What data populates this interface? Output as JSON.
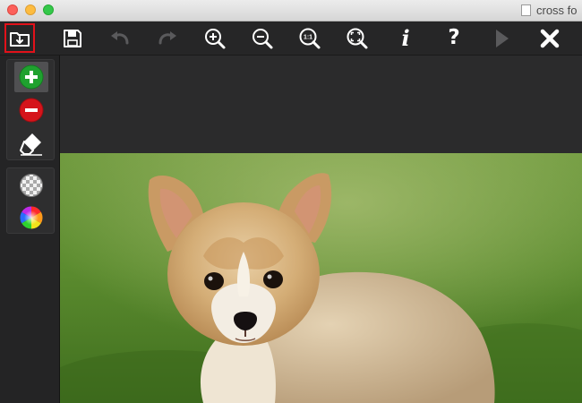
{
  "window": {
    "title": "cross fo",
    "traffic_lights": [
      "close",
      "minimize",
      "maximize"
    ]
  },
  "toolbar": {
    "items": [
      {
        "name": "open-folder",
        "icon": "folder-download-icon",
        "highlighted": true
      },
      {
        "name": "save",
        "icon": "floppy-disk-icon"
      },
      {
        "name": "undo",
        "icon": "undo-arrow-icon",
        "enabled": false
      },
      {
        "name": "redo",
        "icon": "redo-arrow-icon",
        "enabled": false
      },
      {
        "name": "zoom-in",
        "icon": "zoom-in-icon"
      },
      {
        "name": "zoom-out",
        "icon": "zoom-out-icon"
      },
      {
        "name": "actual-size",
        "icon": "zoom-actual-size-icon",
        "label": "1:1"
      },
      {
        "name": "zoom-fit",
        "icon": "zoom-fit-icon"
      },
      {
        "name": "info",
        "icon": "info-icon",
        "label": "i"
      },
      {
        "name": "help",
        "icon": "help-icon",
        "label": "?"
      },
      {
        "name": "run",
        "icon": "play-icon",
        "enabled": false
      },
      {
        "name": "close",
        "icon": "close-x-icon"
      }
    ],
    "highlight_color": "#e2111a"
  },
  "sidebar": {
    "groups": [
      {
        "tools": [
          {
            "name": "add-mark",
            "icon": "plus-circle-icon",
            "color": "#1fa12f",
            "active": true
          },
          {
            "name": "remove-mark",
            "icon": "minus-circle-icon",
            "color": "#d5141b"
          },
          {
            "name": "eraser",
            "icon": "eraser-icon"
          }
        ]
      },
      {
        "tools": [
          {
            "name": "transparency",
            "icon": "checkerboard-icon"
          },
          {
            "name": "color-picker",
            "icon": "color-wheel-icon"
          }
        ]
      }
    ]
  },
  "canvas": {
    "image_subject": "puppy on grass",
    "background_color": "#2b2b2c"
  }
}
